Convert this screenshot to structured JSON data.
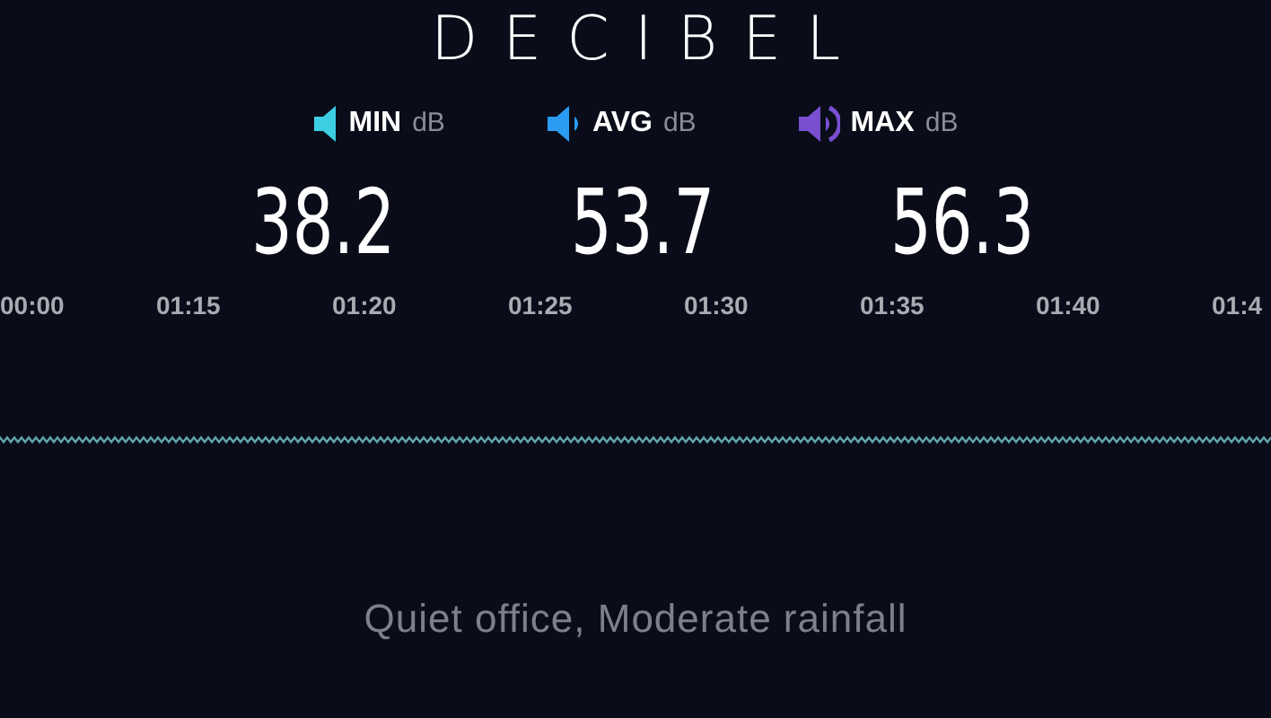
{
  "logo": "DECIBEL",
  "stats": [
    {
      "kind": "min",
      "label": "MIN",
      "unit": "dB",
      "value": "38.2",
      "color": "#3ccfe2"
    },
    {
      "kind": "avg",
      "label": "AVG",
      "unit": "dB",
      "value": "53.7",
      "color": "#2b9cf2"
    },
    {
      "kind": "max",
      "label": "MAX",
      "unit": "dB",
      "value": "56.3",
      "color": "#7a4fd2"
    }
  ],
  "timeline": [
    "00:00",
    "01:15",
    "01:20",
    "01:25",
    "01:30",
    "01:35",
    "01:40",
    "01:4"
  ],
  "description": "Quiet office, Moderate rainfall"
}
